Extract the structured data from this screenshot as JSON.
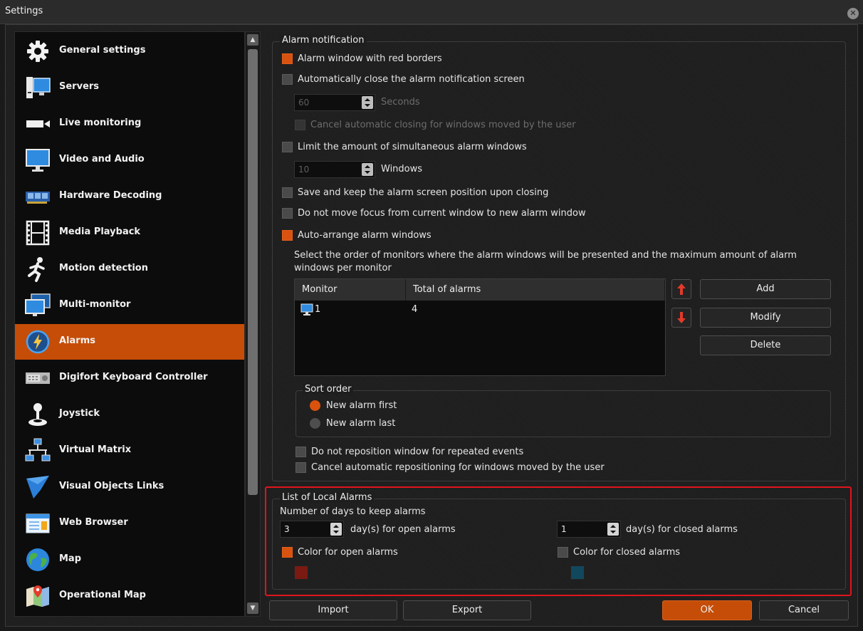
{
  "window": {
    "title": "Settings"
  },
  "sidebar": {
    "items": [
      {
        "label": "General settings",
        "icon": "gear-icon"
      },
      {
        "label": "Servers",
        "icon": "server-icon"
      },
      {
        "label": "Live monitoring",
        "icon": "camera-icon"
      },
      {
        "label": "Video and Audio",
        "icon": "monitor-icon"
      },
      {
        "label": "Hardware Decoding",
        "icon": "gpu-card-icon"
      },
      {
        "label": "Media Playback",
        "icon": "film-icon"
      },
      {
        "label": "Motion detection",
        "icon": "running-man-icon"
      },
      {
        "label": "Multi-monitor",
        "icon": "multi-monitor-icon"
      },
      {
        "label": "Alarms",
        "icon": "alarm-bolt-icon"
      },
      {
        "label": "Digifort Keyboard Controller",
        "icon": "keyboard-controller-icon"
      },
      {
        "label": "Joystick",
        "icon": "joystick-icon"
      },
      {
        "label": "Virtual Matrix",
        "icon": "network-icon"
      },
      {
        "label": "Visual Objects Links",
        "icon": "visual-objects-icon"
      },
      {
        "label": "Web Browser",
        "icon": "browser-icon"
      },
      {
        "label": "Map",
        "icon": "globe-icon"
      },
      {
        "label": "Operational Map",
        "icon": "map-pin-icon"
      }
    ],
    "active_index": 8,
    "scroll_up": "▲",
    "scroll_down": "▼"
  },
  "alarm_notification": {
    "title": "Alarm notification",
    "red_borders": {
      "label": "Alarm window with red borders",
      "checked": true
    },
    "auto_close": {
      "label": "Automatically close the alarm notification screen",
      "checked": false
    },
    "seconds_value": "60",
    "seconds_unit": "Seconds",
    "cancel_auto_close": {
      "label": "Cancel automatic closing for windows moved by the user",
      "checked": false
    },
    "limit_windows": {
      "label": "Limit the amount of simultaneous alarm windows",
      "checked": false
    },
    "windows_value": "10",
    "windows_unit": "Windows",
    "save_position": {
      "label": "Save and keep the alarm screen position upon closing",
      "checked": false
    },
    "no_focus_move": {
      "label": "Do not move focus from current window to new alarm window",
      "checked": false
    },
    "auto_arrange": {
      "label": "Auto-arrange alarm windows",
      "checked": true
    },
    "order_description_line1": "Select the order of monitors where the alarm windows will be presented and the maximum amount of alarm",
    "order_description_line2": "windows per monitor",
    "table": {
      "headers": [
        "Monitor",
        "Total of alarms"
      ],
      "rows": [
        {
          "monitor": "1",
          "total": "4"
        }
      ]
    },
    "buttons": {
      "add": "Add",
      "modify": "Modify",
      "delete": "Delete"
    },
    "sort_order": {
      "title": "Sort order",
      "options": [
        "New alarm first",
        "New alarm last"
      ],
      "selected": 0
    },
    "no_reposition": {
      "label": "Do not reposition window for repeated events",
      "checked": false
    },
    "cancel_reposition": {
      "label": "Cancel automatic repositioning for windows moved by the user",
      "checked": false
    }
  },
  "local_alarms": {
    "title": "List of Local Alarms",
    "days_label": "Number of days to keep alarms",
    "open_days": "3",
    "open_days_unit": "day(s) for open alarms",
    "closed_days": "1",
    "closed_days_unit": "day(s) for closed alarms",
    "color_open": {
      "label": "Color for open alarms",
      "checked": true,
      "color": "#7a1a12"
    },
    "color_closed": {
      "label": "Color for closed alarms",
      "checked": false,
      "color": "#12485e"
    }
  },
  "footer": {
    "import": "Import",
    "export": "Export",
    "ok": "OK",
    "cancel": "Cancel"
  },
  "colors": {
    "accent": "#c64d08",
    "highlight": "#e0141c"
  }
}
